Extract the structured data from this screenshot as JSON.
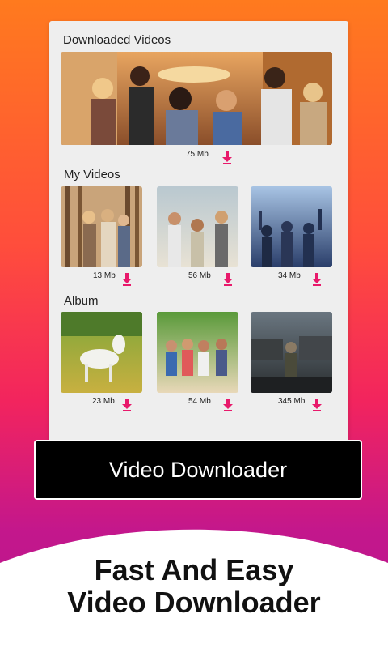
{
  "downloaded": {
    "title": "Downloaded Videos",
    "size": "75 Mb"
  },
  "my_videos": {
    "title": "My Videos",
    "items": [
      {
        "size": "13 Mb"
      },
      {
        "size": "56 Mb"
      },
      {
        "size": "34 Mb"
      }
    ]
  },
  "album": {
    "title": "Album",
    "items": [
      {
        "size": "23 Mb"
      },
      {
        "size": "54 Mb"
      },
      {
        "size": "345 Mb"
      }
    ]
  },
  "banner": {
    "label": "Video Downloader"
  },
  "tagline": {
    "line1": "Fast And Easy",
    "line2": "Video Downloader"
  },
  "colors": {
    "download_arrow": "#e8196b",
    "banner_bg": "#000000",
    "gradient_top": "#ff7a1e",
    "gradient_bottom": "#b8168e"
  }
}
